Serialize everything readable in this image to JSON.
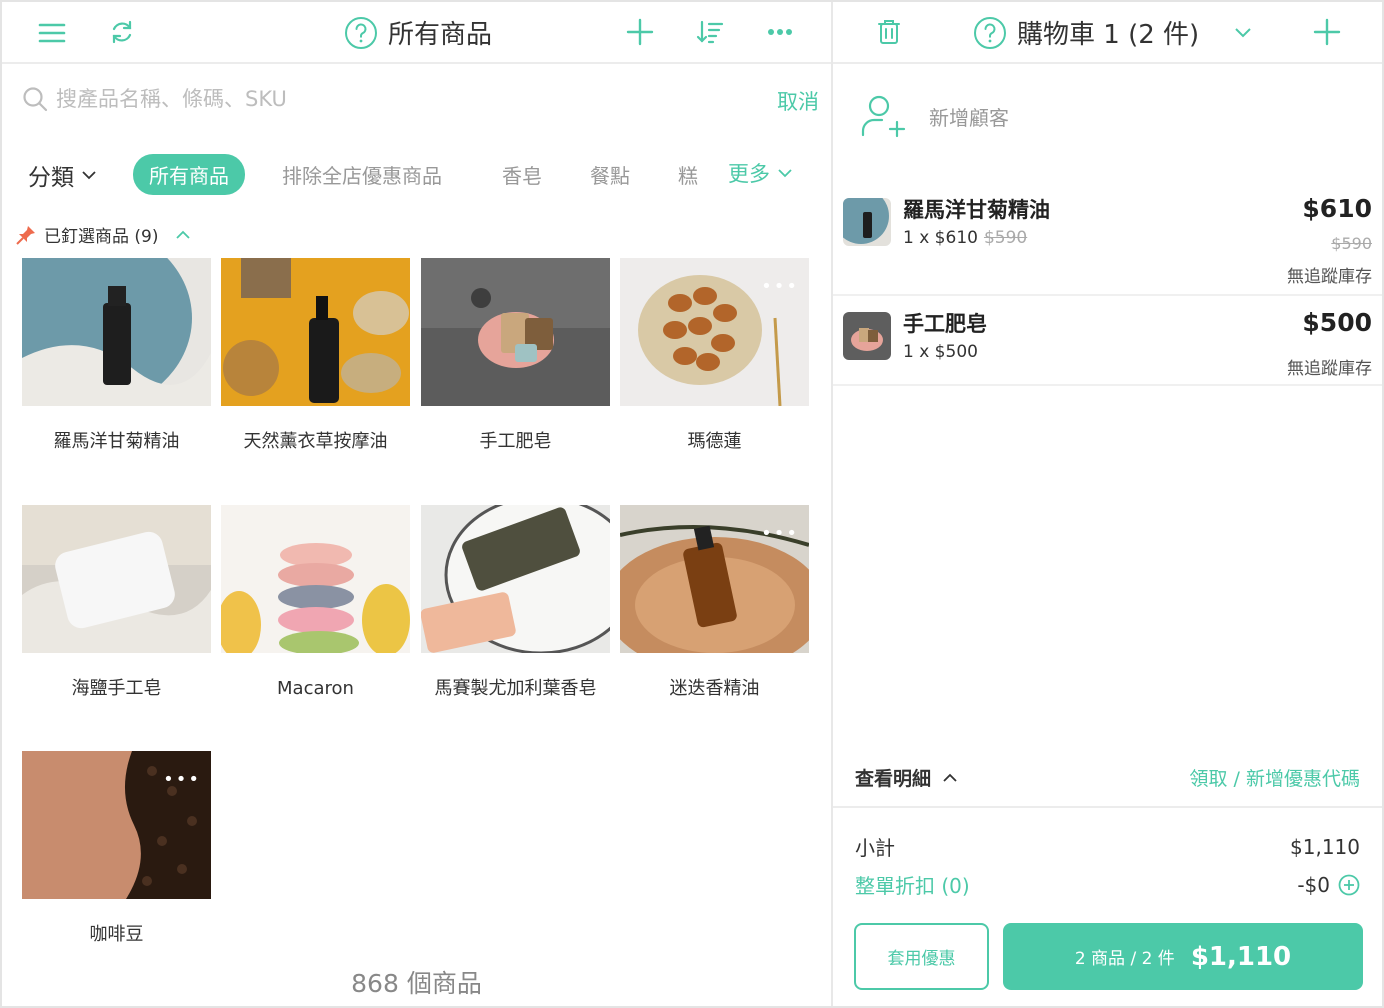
{
  "colors": {
    "accent": "#4cc9a8",
    "border": "#ececec",
    "muted": "#999999"
  },
  "left": {
    "title": "所有商品",
    "search": {
      "placeholder": "搜產品名稱、條碼、SKU",
      "cancel": "取消"
    },
    "filters": {
      "category_label": "分類",
      "chips": [
        "所有商品",
        "排除全店優惠商品",
        "香皂",
        "餐點",
        "糕"
      ],
      "more": "更多"
    },
    "pinned_label": "已釘選商品 (9)",
    "products": [
      {
        "name": "羅馬洋甘菊精油",
        "icon": "essential-oil-image"
      },
      {
        "name": "天然薰衣草按摩油",
        "icon": "massage-oil-image"
      },
      {
        "name": "手工肥皂",
        "icon": "handmade-soap-image"
      },
      {
        "name": "瑪德蓮",
        "icon": "madeleine-image",
        "dots": "•••"
      },
      {
        "name": "海鹽手工皂",
        "icon": "sea-salt-soap-image"
      },
      {
        "name": "Macaron",
        "icon": "macaron-image"
      },
      {
        "name": "馬賽製尤加利葉香皂",
        "icon": "marseille-soap-image"
      },
      {
        "name": "迷迭香精油",
        "icon": "rosemary-oil-image",
        "dots": "•••"
      },
      {
        "name": "咖啡豆",
        "icon": "coffee-beans-image",
        "dots": "•••"
      }
    ],
    "product_count": "868 個商品"
  },
  "right": {
    "title": "購物車 1 (2 件)",
    "add_customer": "新增顧客",
    "items": [
      {
        "name": "羅馬洋甘菊精油",
        "qty": "1 x $610",
        "orig_inline": "$590",
        "price": "$610",
        "orig": "$590",
        "stock": "無追蹤庫存"
      },
      {
        "name": "手工肥皂",
        "qty": "1 x $500",
        "price": "$500",
        "stock": "無追蹤庫存"
      }
    ],
    "detail_toggle": "查看明細",
    "coupon_link": "領取 / 新增優惠代碼",
    "subtotal_label": "小計",
    "subtotal_value": "$1,110",
    "discount_label": "整單折扣 (0)",
    "discount_value": "-$0",
    "apply_button": "套用優惠",
    "checkout": {
      "summary": "2 商品 / 2 件",
      "total": "$1,110"
    }
  }
}
